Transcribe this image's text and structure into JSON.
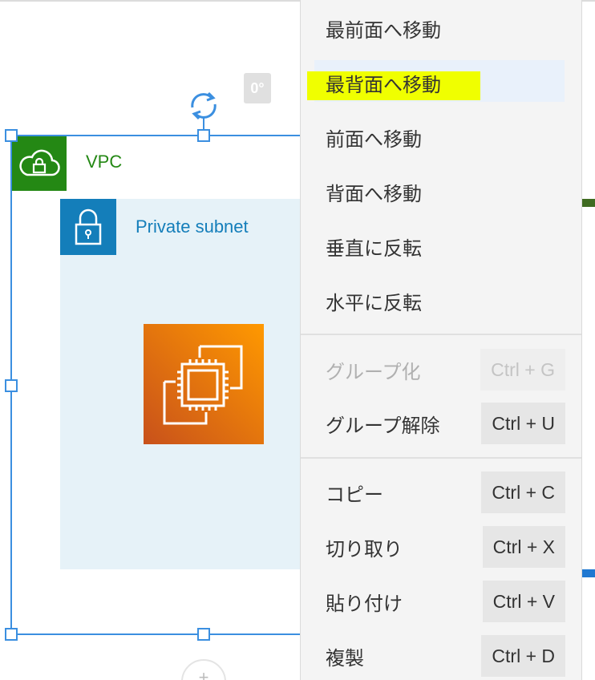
{
  "canvas": {
    "vpc_label": "VPC",
    "subnet_label": "Private subnet",
    "rotation_angle": "0°",
    "icons": {
      "vpc": "cloud-lock-icon",
      "subnet": "padlock-icon",
      "ec2": "ec2-instance-icon",
      "rotate": "rotate-icon"
    },
    "colors": {
      "vpc_green": "#248814",
      "subnet_blue": "#147eba",
      "subnet_fill": "#e6f2f8",
      "ec2_orange": "#ff9900",
      "selection_blue": "#3b8fe0"
    }
  },
  "context_menu": {
    "items": [
      {
        "label": "最前面へ移動"
      },
      {
        "label": "最背面へ移動",
        "highlighted": true
      },
      {
        "label": "前面へ移動"
      },
      {
        "label": "背面へ移動"
      },
      {
        "label": "垂直に反転"
      },
      {
        "label": "水平に反転"
      },
      {
        "label": "グループ化",
        "shortcut": "Ctrl + G",
        "disabled": true
      },
      {
        "label": "グループ解除",
        "shortcut": "Ctrl + U"
      },
      {
        "label": "コピー",
        "shortcut": "Ctrl + C"
      },
      {
        "label": "切り取り",
        "shortcut": "Ctrl + X"
      },
      {
        "label": "貼り付け",
        "shortcut": "Ctrl + V"
      },
      {
        "label": "複製",
        "shortcut": "Ctrl + D"
      }
    ],
    "highlight_color": "#f0ff00"
  }
}
